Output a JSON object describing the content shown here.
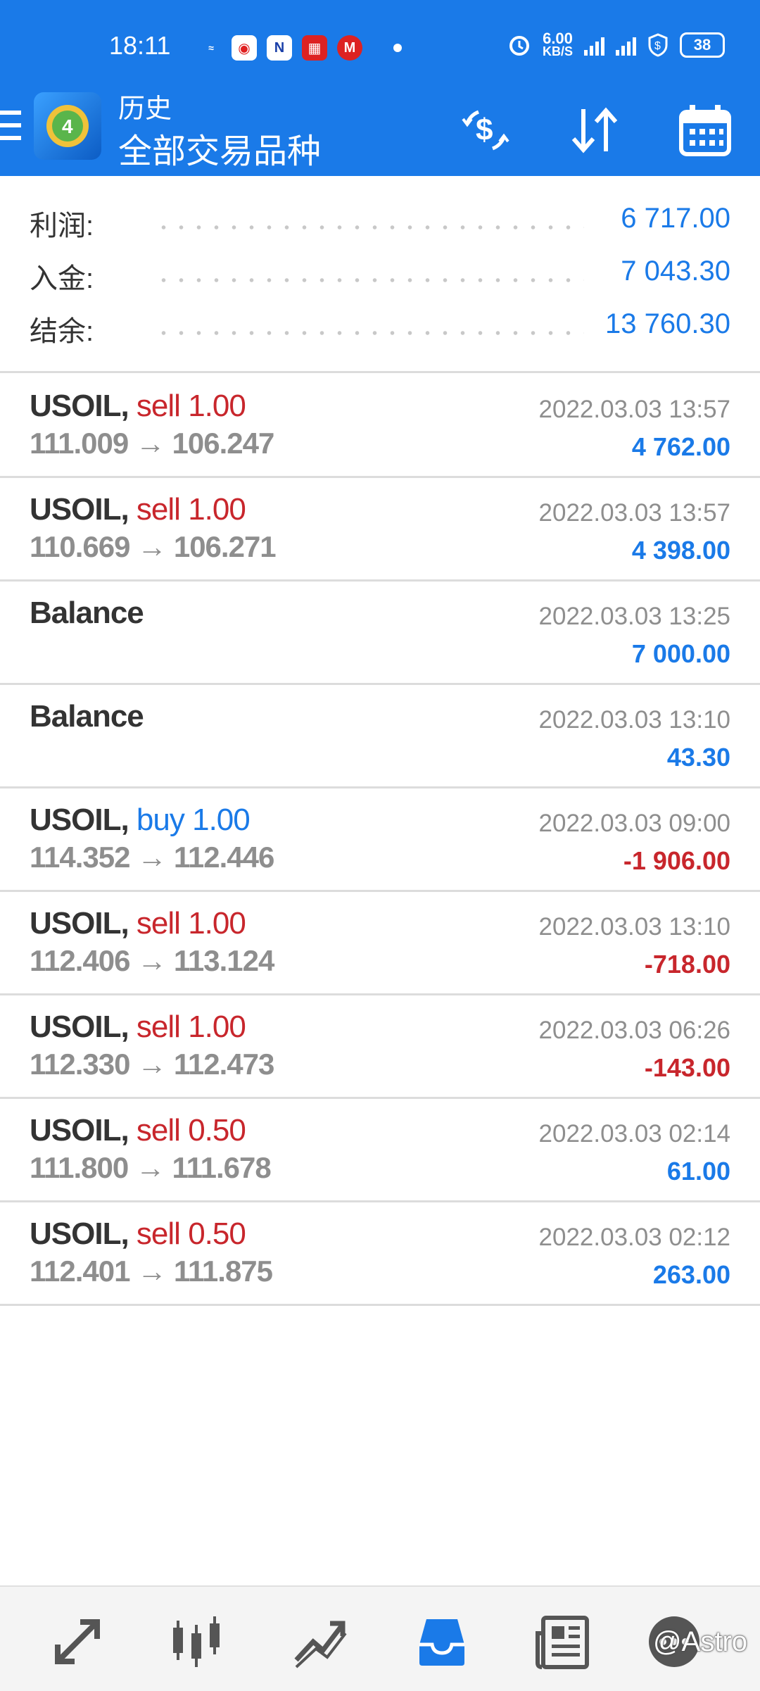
{
  "status_bar": {
    "time": "18:11",
    "net_speed_value": "6.00",
    "net_speed_unit": "KB/S",
    "battery": "38",
    "icons": [
      "exness-icon",
      "weibo-icon",
      "news-icon",
      "red-app-icon",
      "mcdonalds-icon",
      "alarm-icon",
      "signal-icon",
      "5g-signal-icon",
      "shield-icon",
      "battery-icon"
    ]
  },
  "toolbar": {
    "title": "历史",
    "subtitle": "全部交易品种",
    "icons": [
      "menu-icon",
      "mt4-logo",
      "currency-exchange-icon",
      "sort-icon",
      "calendar-icon"
    ]
  },
  "summary": [
    {
      "label": "利润:",
      "value": "6 717.00"
    },
    {
      "label": "入金:",
      "value": "7 043.30"
    },
    {
      "label": "结余:",
      "value": "13 760.30"
    }
  ],
  "trades": [
    {
      "symbol": "USOIL,",
      "type": "sell",
      "volume": "1.00",
      "prices": "111.009 → 106.247",
      "time": "2022.03.03 13:57",
      "profit": "4 762.00",
      "sign": "pos"
    },
    {
      "symbol": "USOIL,",
      "type": "sell",
      "volume": "1.00",
      "prices": "110.669 → 106.271",
      "time": "2022.03.03 13:57",
      "profit": "4 398.00",
      "sign": "pos"
    },
    {
      "symbol": "Balance",
      "type": "",
      "volume": "",
      "prices": "",
      "time": "2022.03.03 13:25",
      "profit": "7 000.00",
      "sign": "pos"
    },
    {
      "symbol": "Balance",
      "type": "",
      "volume": "",
      "prices": "",
      "time": "2022.03.03 13:10",
      "profit": "43.30",
      "sign": "pos"
    },
    {
      "symbol": "USOIL,",
      "type": "buy",
      "volume": "1.00",
      "prices": "114.352 → 112.446",
      "time": "2022.03.03 09:00",
      "profit": "-1 906.00",
      "sign": "neg"
    },
    {
      "symbol": "USOIL,",
      "type": "sell",
      "volume": "1.00",
      "prices": "112.406 → 113.124",
      "time": "2022.03.03 13:10",
      "profit": "-718.00",
      "sign": "neg"
    },
    {
      "symbol": "USOIL,",
      "type": "sell",
      "volume": "1.00",
      "prices": "112.330 → 112.473",
      "time": "2022.03.03 06:26",
      "profit": "-143.00",
      "sign": "neg"
    },
    {
      "symbol": "USOIL,",
      "type": "sell",
      "volume": "0.50",
      "prices": "111.800 → 111.678",
      "time": "2022.03.03 02:14",
      "profit": "61.00",
      "sign": "pos"
    },
    {
      "symbol": "USOIL,",
      "type": "sell",
      "volume": "0.50",
      "prices": "112.401 → 111.875",
      "time": "2022.03.03 02:12",
      "profit": "263.00",
      "sign": "pos"
    }
  ],
  "bottom_nav": [
    "quotes-icon",
    "chart-icon",
    "trade-icon",
    "history-icon",
    "news-icon",
    "chat-icon"
  ],
  "watermark": "@Astro",
  "colors": {
    "accent": "#1a7ae8",
    "loss": "#c8262c",
    "muted": "#8e8e8e"
  }
}
